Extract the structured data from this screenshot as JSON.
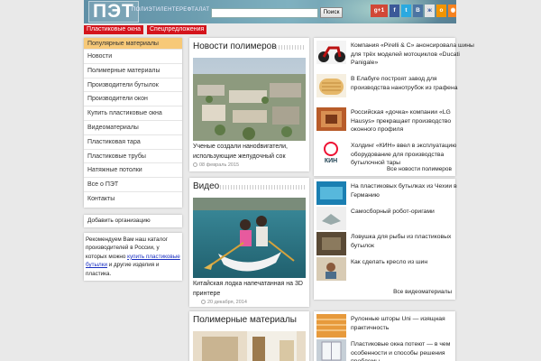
{
  "header": {
    "logo": "ПЭТ",
    "tagline": "ПОЛИЭТИЛЕНТЕРЕФТАЛАТ",
    "search": {
      "value": "",
      "placeholder": "",
      "button": "Поиск"
    },
    "social": [
      {
        "label": "g+1",
        "icon": "google-plus-icon",
        "color": "#d14836"
      },
      {
        "label": "f",
        "icon": "facebook-icon",
        "color": "#3b5998"
      },
      {
        "label": "t",
        "icon": "twitter-icon",
        "color": "#2aa9e0"
      },
      {
        "label": "В",
        "icon": "vk-icon",
        "color": "#4c75a3"
      },
      {
        "label": "ж",
        "icon": "livejournal-icon",
        "color": "#e4e4e4"
      },
      {
        "label": "о",
        "icon": "odnoklassniki-icon",
        "color": "#f29400"
      },
      {
        "label": "◉",
        "icon": "rss-icon",
        "color": "#f58220"
      }
    ]
  },
  "topnav": [
    "Пластиковые окна",
    "Спецпредложения"
  ],
  "sidebar": {
    "menu_title": "Популярные материалы",
    "items": [
      "Новости",
      "Полимерные материалы",
      "Производители бутылок",
      "Производители окон",
      "Купить пластиковые окна",
      "Видеоматериалы",
      "Пластиковая тара",
      "Пластиковые трубы",
      "Натяжные потолки",
      "Все о ПЭТ",
      "Контакты"
    ],
    "add_org": "Добавить организацию",
    "promo": {
      "before": "Рекомендуем Вам наш каталог производителей в России, у которых можно ",
      "link": "купить пластиковые бутылки",
      "after": " и другие изделия и пластика."
    }
  },
  "news": {
    "title": "Новости полимеров",
    "caption": "Ученые создали наноdвигатели, использующие желудочный сок",
    "date": "08 февраль 2015"
  },
  "video": {
    "title": "Видео",
    "caption": "Китайская лодка напечатанная на 3D принтере",
    "date": "20 декабря, 2014"
  },
  "materials": {
    "title": "Полимерные материалы"
  },
  "right_news": {
    "items": [
      "Компания «Pirelli & C» анонсировала шины для трёх моделей мотоциклов «Ducati Panigale»",
      "В Елабуге построят завод для производства нанотрубок из графена",
      "Российская «дочка» компании «LG Hausys» прекращает производство оконного профиля",
      "Холдинг «КИН» ввел в эксплуатацию оборудование для производства бутылочной тары"
    ],
    "more": "Все новости полимеров"
  },
  "right_video": {
    "items": [
      "На пластиковых бутылках из Чехии в Германию",
      "Самосборный робот-оригами",
      "Ловушка для рыбы из пластиковых бутылок",
      "Как сделать кресло из шин"
    ],
    "more": "Все видеоматериалы"
  },
  "right_materials": {
    "items": [
      "Рулонные шторы Uni — изящная практичность",
      "Пластиковые окна потеют — в чем особенности и способы решения проблемы"
    ]
  },
  "colors": {
    "header": "#6d9eb0",
    "topnav": "#d4141c",
    "menu_head": "#f7c978",
    "link": "#1a2fc0"
  }
}
